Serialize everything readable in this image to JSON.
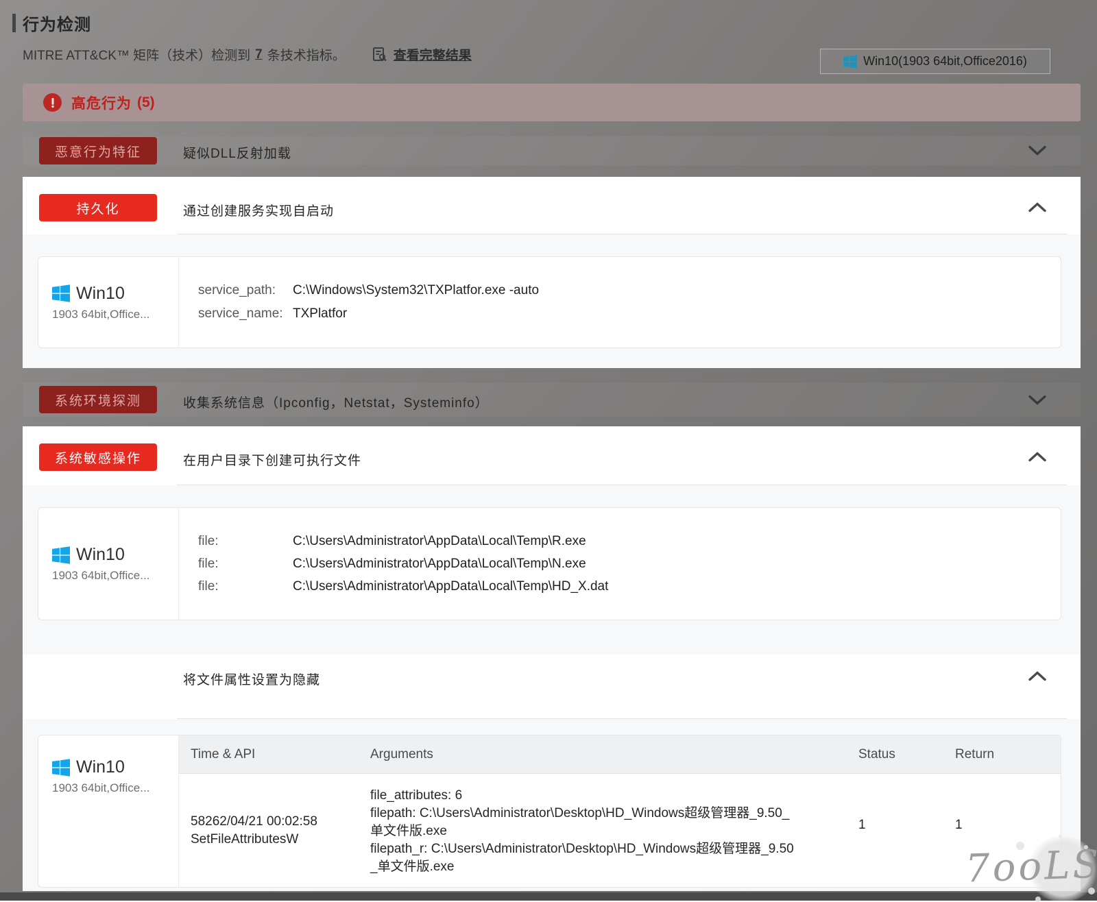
{
  "colors": {
    "accent_red": "#e62a20",
    "dimmed_dark_red": "#8e201d",
    "banner_background": "#a89394",
    "banner_red_text": "#c1201c",
    "windows_logo_blue": "#14a5e8"
  },
  "header": {
    "title": "行为检测",
    "subtitle_prefix": "MITRE ATT&CK™ 矩阵（技术）检测到",
    "indicator_count": "7",
    "subtitle_suffix": "条技术指标。",
    "view_full_label": "查看完整结果",
    "env_label": "Win10(1903 64bit,Office2016)"
  },
  "banner": {
    "label": "高危行为",
    "count": "(5)"
  },
  "machine": {
    "name": "Win10",
    "subtitle": "1903 64bit,Office..."
  },
  "sections": {
    "malicious": {
      "tag": "恶意行为特征",
      "title": "疑似DLL反射加载"
    },
    "persistence": {
      "tag": "持久化",
      "title": "通过创建服务实现自启动",
      "kv": [
        {
          "key": "service_path:",
          "value": "C:\\Windows\\System32\\TXPlatfor.exe -auto"
        },
        {
          "key": "service_name:",
          "value": "TXPlatfor"
        }
      ]
    },
    "env_probe": {
      "tag": "系统环境探测",
      "title": "收集系统信息（Ipconfig，Netstat，Systeminfo）"
    },
    "sensitive": {
      "tag": "系统敏感操作",
      "title": "在用户目录下创建可执行文件",
      "files": [
        {
          "key": "file:",
          "value": "C:\\Users\\Administrator\\AppData\\Local\\Temp\\R.exe"
        },
        {
          "key": "file:",
          "value": "C:\\Users\\Administrator\\AppData\\Local\\Temp\\N.exe"
        },
        {
          "key": "file:",
          "value": "C:\\Users\\Administrator\\AppData\\Local\\Temp\\HD_X.dat"
        }
      ]
    },
    "hide_attr": {
      "title": "将文件属性设置为隐藏",
      "table": {
        "headers": [
          "Time & API",
          "Arguments",
          "Status",
          "Return"
        ],
        "row": {
          "time_lines": [
            "58262/04/21 00:02:58",
            "SetFileAttributesW"
          ],
          "args_lines": [
            "file_attributes: 6",
            "filepath: C:\\Users\\Administrator\\Desktop\\HD_Windows超级管理器_9.50_",
            "单文件版.exe",
            "filepath_r: C:\\Users\\Administrator\\Desktop\\HD_Windows超级管理器_9.50",
            "_单文件版.exe"
          ],
          "status": "1",
          "return": "1"
        }
      }
    }
  },
  "watermark": "7ooLS"
}
